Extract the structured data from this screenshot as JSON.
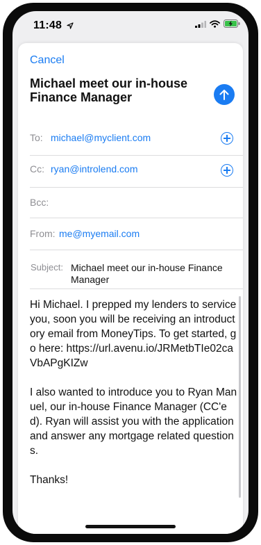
{
  "status_bar": {
    "time": "11:48",
    "location_icon": "location-arrow-icon"
  },
  "compose": {
    "cancel_label": "Cancel",
    "title": "Michael meet our in-house Finance Manager",
    "to": {
      "label": "To:",
      "value": "michael@myclient.com"
    },
    "cc": {
      "label": "Cc:",
      "value": "ryan@introlend.com"
    },
    "bcc": {
      "label": "Bcc:",
      "value": ""
    },
    "from": {
      "label": "From:",
      "value": "me@myemail.com"
    },
    "subject": {
      "label": "Subject:",
      "value": "Michael meet our in-house Finance Manager"
    },
    "body": "Hi Michael. I prepped my lenders to service you, soon you will be receiving an introductory email from MoneyTips. To get started, go here: https://url.avenu.io/JRMetbTIe02caVbAPgKIZw\n\nI also wanted to introduce you to Ryan Manuel, our in-house Finance Manager (CC'ed). Ryan will assist you with the application and answer any mortgage related questions.\n\nThanks!"
  },
  "colors": {
    "accent": "#1a7cf2"
  }
}
